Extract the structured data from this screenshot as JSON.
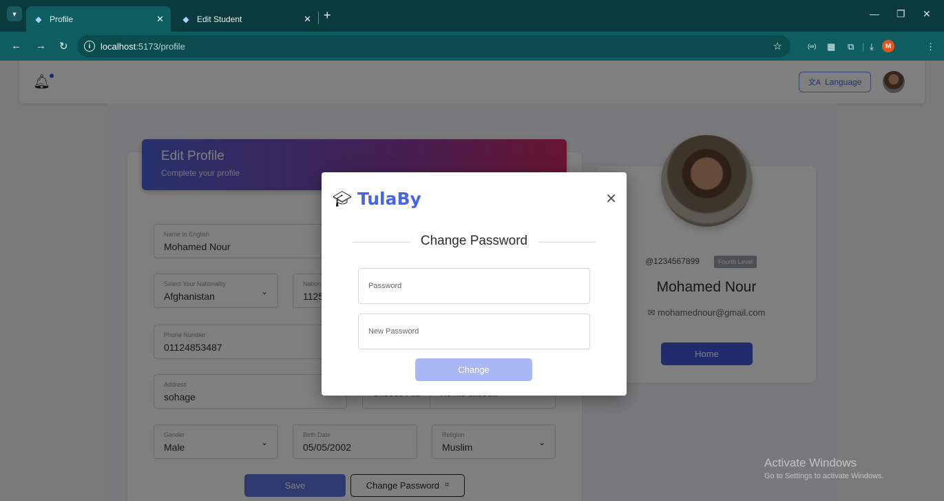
{
  "browser": {
    "tabs": [
      {
        "title": "Profile"
      },
      {
        "title": "Edit Student"
      }
    ],
    "url_host": "localhost",
    "url_path": ":5173/profile"
  },
  "header": {
    "language_label": "Language"
  },
  "edit_profile": {
    "title": "Edit Profile",
    "subtitle": "Complete your profile",
    "fields": {
      "name_english": {
        "label": "Name In English",
        "value": "Mohamed Nour"
      },
      "nationality": {
        "label": "Select Your Nationality",
        "value": "Afghanistan"
      },
      "national_id": {
        "label": "Nation",
        "value": "1125"
      },
      "phone": {
        "label": "Phone Number",
        "value": "01124853487"
      },
      "address": {
        "label": "Address",
        "value": "sohage"
      },
      "file": {
        "button": "Choose File",
        "status": "No file chosen"
      },
      "gender": {
        "label": "Gender",
        "value": "Male"
      },
      "birth_date": {
        "label": "Birth Date",
        "value": "05/05/2002"
      },
      "religion": {
        "label": "Religion",
        "value": "Muslim"
      }
    },
    "save_label": "Save",
    "change_password_label": "Change Password"
  },
  "profile_card": {
    "handle": "@1234567899",
    "level": "Fourth Level",
    "name": "Mohamed Nour",
    "email": "mohamednour@gmail.com",
    "home_label": "Home"
  },
  "modal": {
    "brand": "TulaBy",
    "title": "Change Password",
    "password_placeholder": "Password",
    "new_password_placeholder": "New Password",
    "change_label": "Change"
  },
  "watermark": {
    "line1": "Activate Windows",
    "line2": "Go to Settings to activate Windows."
  },
  "colors": {
    "accent": "#4765e8",
    "chrome": "#0e5e61"
  }
}
